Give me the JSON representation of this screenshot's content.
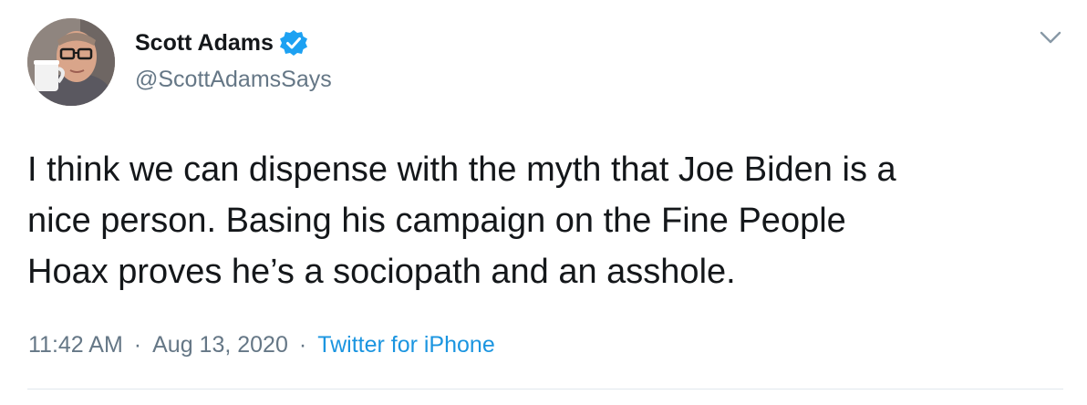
{
  "tweet": {
    "author": {
      "display_name": "Scott Adams",
      "handle": "@ScottAdamsSays",
      "verified": true,
      "avatar_icon": "profile-photo"
    },
    "text": "I think we can dispense with the myth that Joe Biden is a\nnice person. Basing his campaign on the Fine People\nHoax proves he’s a sociopath and an asshole.",
    "time": "11:42 AM",
    "date": "Aug 13, 2020",
    "separator": "·",
    "source": "Twitter for iPhone",
    "menu_icon": "chevron-down-icon"
  },
  "colors": {
    "text_primary": "#14171a",
    "text_secondary": "#657786",
    "accent": "#1b95e0",
    "verified_badge": "#1da1f2",
    "divider": "#e1e8ed"
  }
}
